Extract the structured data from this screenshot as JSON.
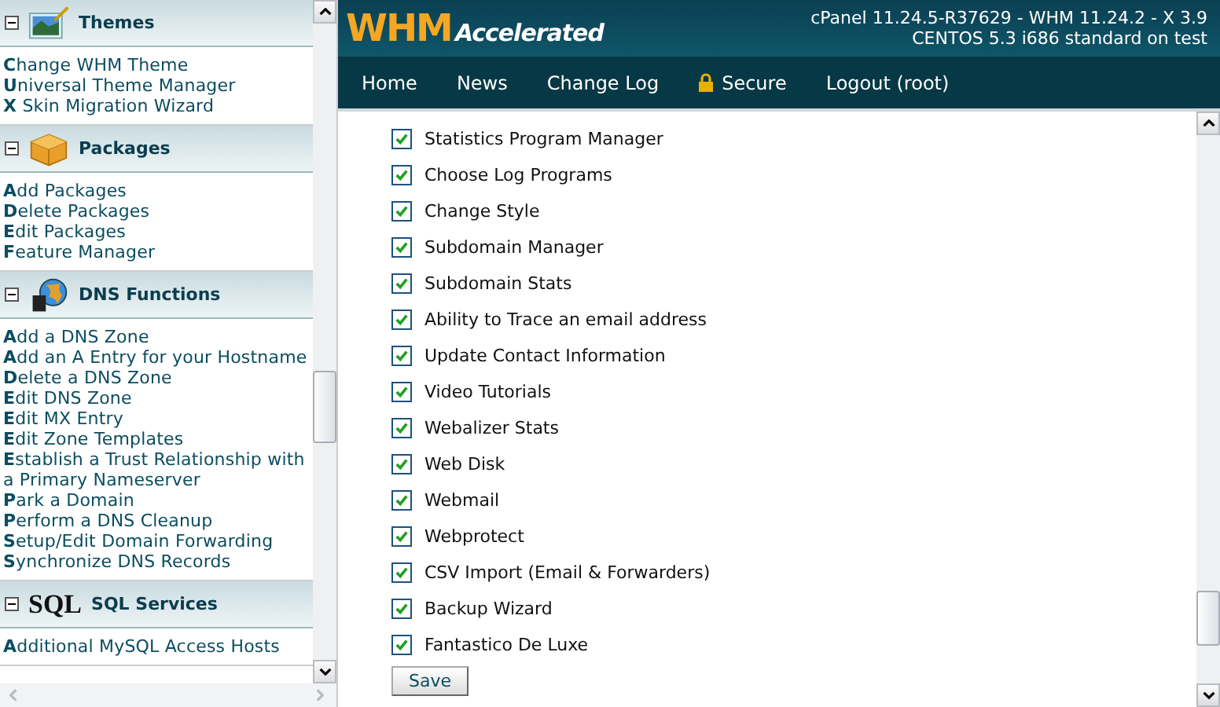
{
  "sidebar": {
    "sections": [
      {
        "title": "Themes",
        "kind": "picture",
        "expanded": true,
        "items": [
          "**C**hange WHM Theme",
          "**U**niversal Theme Manager",
          "**X** Skin Migration Wizard"
        ]
      },
      {
        "title": "Packages",
        "kind": "box",
        "expanded": true,
        "items": [
          "**A**dd Packages",
          "**D**elete Packages",
          "**E**dit Packages",
          "**F**eature Manager"
        ]
      },
      {
        "title": "DNS Functions",
        "kind": "globe",
        "expanded": true,
        "items": [
          "**A**dd a DNS Zone",
          "**A**dd an A Entry for your Hostname",
          "**D**elete a DNS Zone",
          "**E**dit DNS Zone",
          "**E**dit MX Entry",
          "**E**dit Zone Templates",
          "**E**stablish a Trust Relationship with a Primary Nameserver",
          "**P**ark a Domain",
          "**P**erform a DNS Cleanup",
          "**S**etup/Edit Domain Forwarding",
          "**S**ynchronize DNS Records"
        ]
      },
      {
        "title": "SQL Services",
        "kind": "text",
        "icon_text": "SQL",
        "expanded": true,
        "items": [
          "**A**dditional MySQL Access Hosts"
        ]
      }
    ]
  },
  "header": {
    "logo_main": "WHM",
    "logo_sub": "Accelerated",
    "version": "cPanel 11.24.5-R37629 - WHM 11.24.2 - X 3.9",
    "system": "CENTOS 5.3 i686 standard on test"
  },
  "nav": [
    {
      "label": "Home",
      "kind": "link"
    },
    {
      "label": "News",
      "kind": "link"
    },
    {
      "label": "Change Log",
      "kind": "link"
    },
    {
      "label": "Secure",
      "kind": "lock"
    },
    {
      "label": "Logout (root)",
      "kind": "link"
    }
  ],
  "features": [
    {
      "label": "Statistics Program Manager",
      "checked": true
    },
    {
      "label": "Choose Log Programs",
      "checked": true
    },
    {
      "label": "Change Style",
      "checked": true
    },
    {
      "label": "Subdomain Manager",
      "checked": true
    },
    {
      "label": "Subdomain Stats",
      "checked": true
    },
    {
      "label": "Ability to Trace an email address",
      "checked": true
    },
    {
      "label": "Update Contact Information",
      "checked": true
    },
    {
      "label": "Video Tutorials",
      "checked": true
    },
    {
      "label": "Webalizer Stats",
      "checked": true
    },
    {
      "label": "Web Disk",
      "checked": true
    },
    {
      "label": "Webmail",
      "checked": true
    },
    {
      "label": "Webprotect",
      "checked": true
    },
    {
      "label": "CSV Import (Email & Forwarders)",
      "checked": true
    },
    {
      "label": "Backup Wizard",
      "checked": true
    },
    {
      "label": "Fantastico De Luxe",
      "checked": true
    }
  ],
  "save_button": "Save"
}
